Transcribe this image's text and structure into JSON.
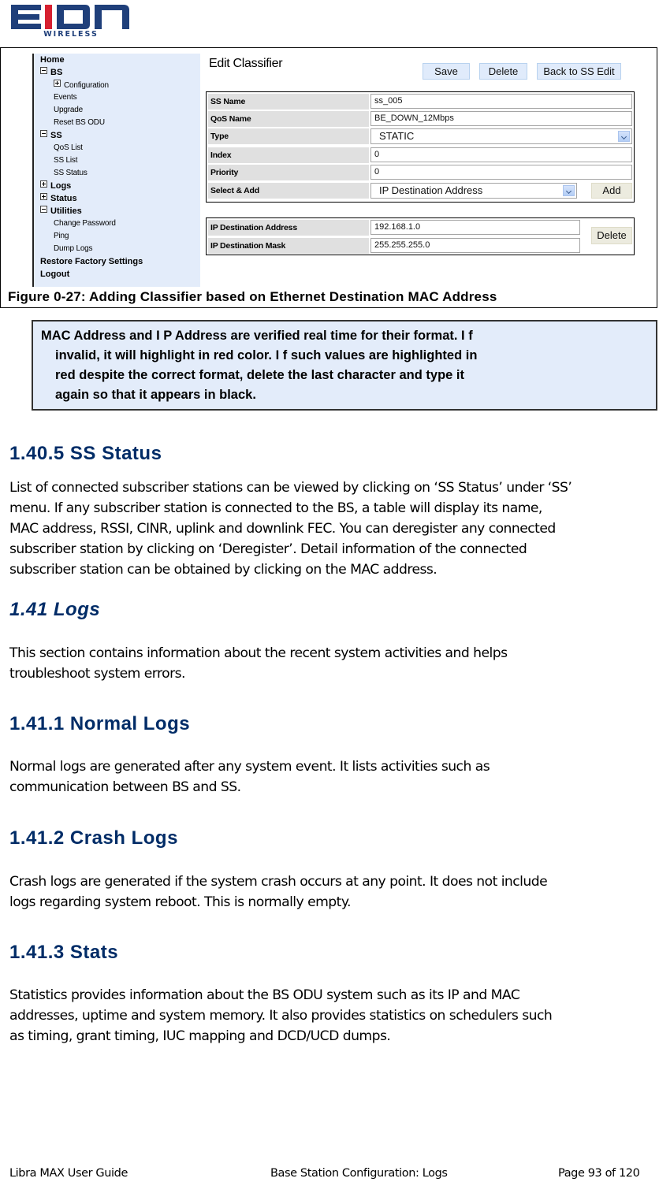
{
  "logo": {
    "brand": "EION",
    "tagline": "WIRELESS",
    "colors": {
      "blue": "#1f3f7a",
      "red": "#d62030"
    }
  },
  "figure": {
    "sidebar": {
      "items": [
        {
          "label": "Home",
          "level": 0,
          "toggle": "none"
        },
        {
          "label": "BS",
          "level": 0,
          "toggle": "minus"
        },
        {
          "label": "Configuration",
          "level": 1,
          "toggle": "plus"
        },
        {
          "label": "Events",
          "level": 1,
          "toggle": "none"
        },
        {
          "label": "Upgrade",
          "level": 1,
          "toggle": "none"
        },
        {
          "label": "Reset BS ODU",
          "level": 1,
          "toggle": "none"
        },
        {
          "label": "SS",
          "level": 0,
          "toggle": "minus"
        },
        {
          "label": "QoS List",
          "level": 1,
          "toggle": "none"
        },
        {
          "label": "SS List",
          "level": 1,
          "toggle": "none"
        },
        {
          "label": "SS Status",
          "level": 1,
          "toggle": "none"
        },
        {
          "label": "Logs",
          "level": 0,
          "toggle": "plus"
        },
        {
          "label": "Status",
          "level": 0,
          "toggle": "plus"
        },
        {
          "label": "Utilities",
          "level": 0,
          "toggle": "minus"
        },
        {
          "label": "Change Password",
          "level": 1,
          "toggle": "none"
        },
        {
          "label": "Ping",
          "level": 1,
          "toggle": "none"
        },
        {
          "label": "Dump Logs",
          "level": 1,
          "toggle": "none"
        },
        {
          "label": "Restore Factory Settings",
          "level": 0,
          "toggle": "none"
        },
        {
          "label": "Logout",
          "level": 0,
          "toggle": "none"
        }
      ]
    },
    "panel": {
      "title": "Edit Classifier",
      "buttons": {
        "save": "Save",
        "delete": "Delete",
        "back": "Back to SS Edit"
      },
      "fields": {
        "ss_name": {
          "label": "SS Name",
          "value": "ss_005"
        },
        "qos_name": {
          "label": "QoS Name",
          "value": "BE_DOWN_12Mbps"
        },
        "type": {
          "label": "Type",
          "value": "STATIC"
        },
        "index": {
          "label": "Index",
          "value": "0"
        },
        "priority": {
          "label": "Priority",
          "value": "0"
        },
        "select_add": {
          "label": "Select & Add",
          "value": "IP Destination Address",
          "add_label": "Add"
        }
      },
      "rules": {
        "ip_dest_addr": {
          "label": "IP Destination Address",
          "value": "192.168.1.0"
        },
        "ip_dest_mask": {
          "label": "IP Destination Mask",
          "value": "255.255.255.0"
        },
        "delete_label": "Delete"
      }
    },
    "caption": "Figure 0-27: Adding Classifier based on Ethernet Destination MAC Address"
  },
  "note": {
    "lines": [
      "MAC Address and I P Address are verified real time for their format. I f",
      "invalid, it will highlight in red color. I f such values are highlighted in",
      "red despite the correct format, delete the last character and type it",
      "again so that it appears in black."
    ]
  },
  "sections": [
    {
      "heading": "1.40.5 SS Status",
      "lines": [
        "List of connected subscriber stations can be viewed by clicking on ‘SS Status’ under ‘SS’",
        "menu. If any subscriber station is connected to the BS, a table will display its name,",
        "MAC address, RSSI, CINR, uplink and downlink FEC. You can deregister any connected",
        "subscriber station by clicking on ‘Deregister’. Detail information of the connected",
        "subscriber station can be obtained by clicking on the MAC address."
      ]
    },
    {
      "heading": "1.41 Logs",
      "lines": [
        "This section contains information about the recent system activities and helps",
        "troubleshoot system errors."
      ]
    },
    {
      "heading": "1.41.1 Normal Logs",
      "lines": [
        "Normal logs are generated after any system event. It lists activities such as",
        "communication between BS and SS."
      ]
    },
    {
      "heading": "1.41.2 Crash Logs",
      "lines": [
        "Crash logs are generated if the system crash occurs at any point. It does not include",
        "logs regarding system reboot. This is normally empty."
      ]
    },
    {
      "heading": "1.41.3 Stats",
      "lines": [
        "Statistics provides information about the BS ODU system such as its IP and MAC",
        "addresses, uptime and system memory. It also provides statistics on schedulers such",
        "as timing, grant timing, IUC mapping and DCD/UCD dumps."
      ]
    }
  ],
  "footer": {
    "left": "Libra MAX User Guide",
    "center": "Base Station Configuration: Logs",
    "right": "Page 93 of 120"
  }
}
